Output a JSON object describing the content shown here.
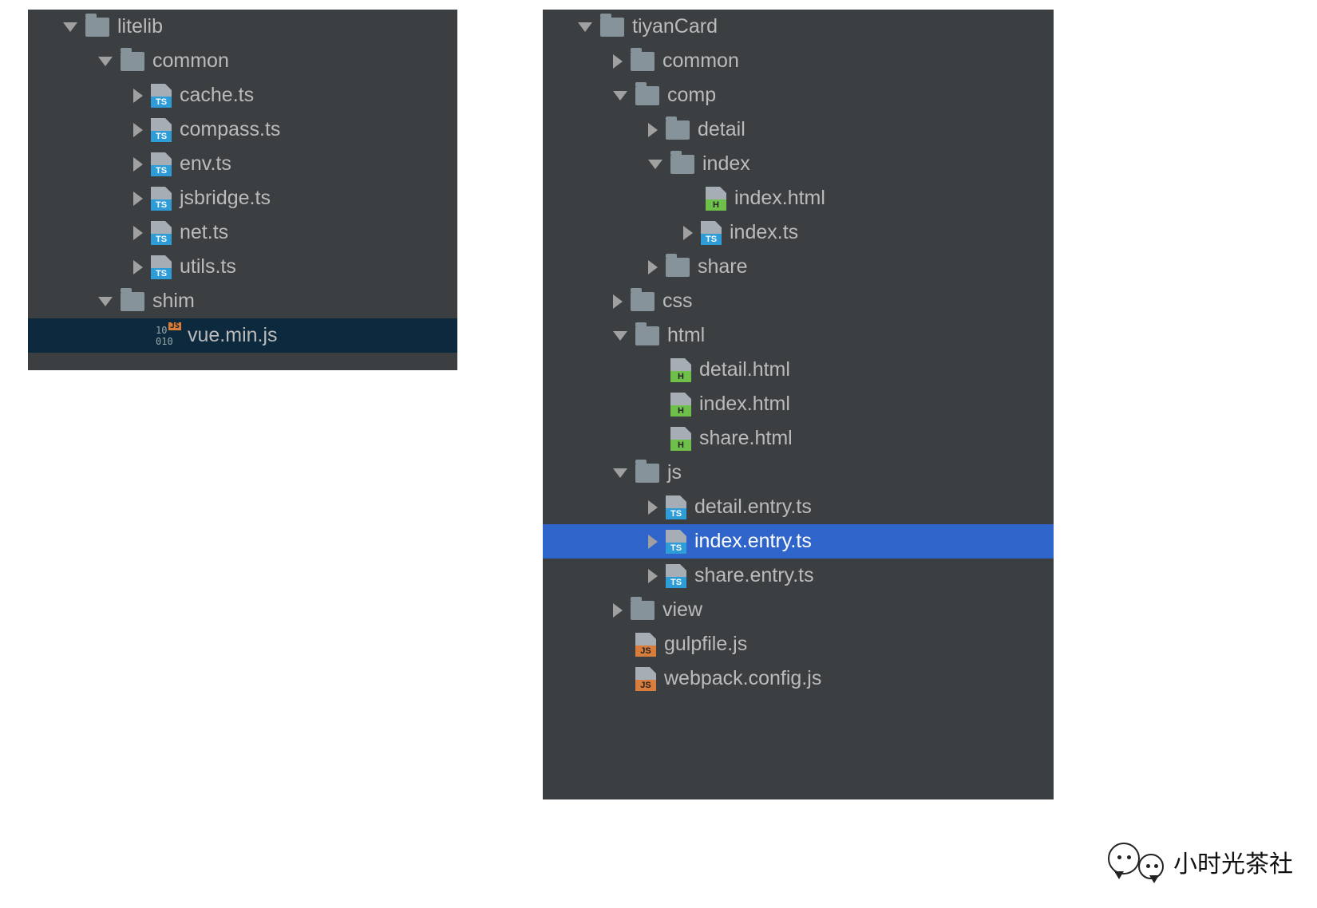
{
  "leftTree": {
    "root": {
      "name": "litelib"
    },
    "common": {
      "name": "common",
      "files": [
        "cache.ts",
        "compass.ts",
        "env.ts",
        "jsbridge.ts",
        "net.ts",
        "utils.ts"
      ]
    },
    "shim": {
      "name": "shim",
      "file": "vue.min.js"
    }
  },
  "rightTree": {
    "root": {
      "name": "tiyanCard"
    },
    "common": {
      "name": "common"
    },
    "comp": {
      "name": "comp",
      "detail": "detail",
      "index": {
        "name": "index",
        "html": "index.html",
        "ts": "index.ts"
      },
      "share": "share"
    },
    "css": {
      "name": "css"
    },
    "html": {
      "name": "html",
      "files": [
        "detail.html",
        "index.html",
        "share.html"
      ]
    },
    "js": {
      "name": "js",
      "detail": "detail.entry.ts",
      "index": "index.entry.ts",
      "share": "share.entry.ts"
    },
    "view": {
      "name": "view"
    },
    "gulpfile": "gulpfile.js",
    "webpack": "webpack.config.js"
  },
  "watermark": {
    "text": "小时光茶社"
  },
  "fileTagLabels": {
    "ts": "TS",
    "html": "H",
    "js": "JS"
  }
}
